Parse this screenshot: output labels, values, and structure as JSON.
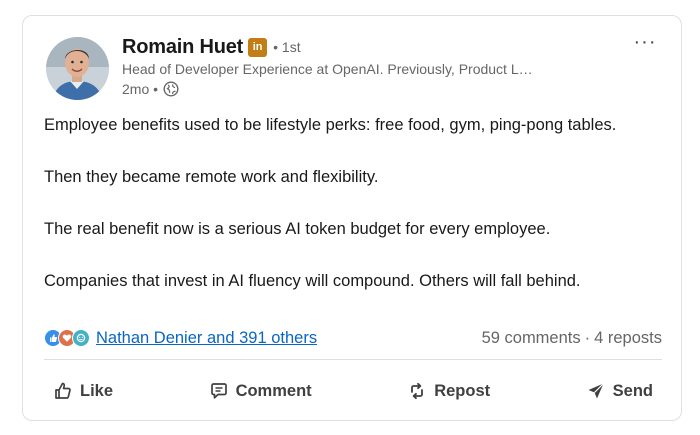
{
  "post": {
    "author": {
      "name": "Romain Huet",
      "badge": "in",
      "degree": "• 1st",
      "headline": "Head of Developer Experience at OpenAI. Previously, Product L…",
      "time": "2mo •",
      "visibility_icon": "globe-icon"
    },
    "menu_icon": "···",
    "paragraphs": [
      "Employee benefits used to be lifestyle perks: free food, gym, ping-pong tables.",
      "Then they became remote work and flexibility.",
      "The real benefit now is a serious AI token budget for every employee.",
      "Companies that invest in AI fluency will compound. Others will fall behind."
    ],
    "social": {
      "reactions": [
        "like-icon",
        "love-icon",
        "insightful-icon"
      ],
      "reactors_text": "Nathan Denier and 391 others",
      "comments_text": "59 comments",
      "separator": "·",
      "reposts_text": "4 reposts"
    },
    "actions": [
      {
        "label": "Like",
        "icon": "thumbs-up-icon"
      },
      {
        "label": "Comment",
        "icon": "comment-icon"
      },
      {
        "label": "Repost",
        "icon": "repost-icon"
      },
      {
        "label": "Send",
        "icon": "send-icon"
      }
    ]
  },
  "colors": {
    "link": "#0a66c2",
    "secondary_text": "#666666",
    "badge": "#c37d16",
    "like_blue": "#378fe9",
    "love_red": "#df704d",
    "insightful_teal": "#44b2c6"
  }
}
